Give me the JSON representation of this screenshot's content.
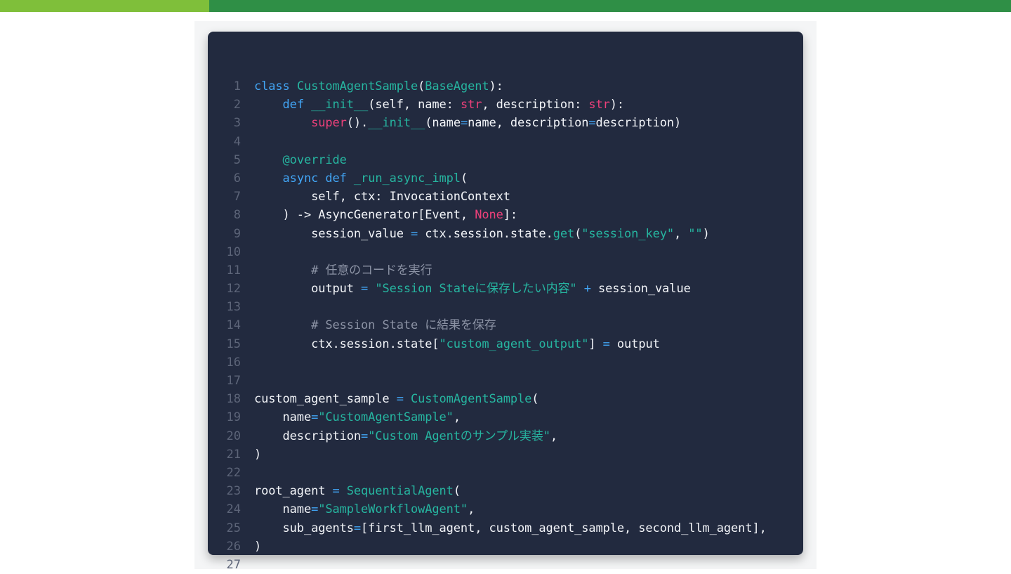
{
  "colors": {
    "top_bar_light": "#7fbf3a",
    "top_bar_dark": "#2f8f46",
    "code_background": "#222a3f",
    "keyword": "#42a5f5",
    "class_name": "#26b5a0",
    "builtin": "#ec407a",
    "string": "#26b5a0",
    "comment": "#8c93a5",
    "plain": "#f2f4f8",
    "line_number": "#5d6579"
  },
  "code": {
    "language": "python",
    "lines": [
      {
        "number": "1",
        "tokens": [
          {
            "t": "keyword",
            "v": "class"
          },
          {
            "t": "plain",
            "v": " "
          },
          {
            "t": "class",
            "v": "CustomAgentSample"
          },
          {
            "t": "plain",
            "v": "("
          },
          {
            "t": "class",
            "v": "BaseAgent"
          },
          {
            "t": "plain",
            "v": "):"
          }
        ]
      },
      {
        "number": "2",
        "tokens": [
          {
            "t": "plain",
            "v": "    "
          },
          {
            "t": "keyword",
            "v": "def"
          },
          {
            "t": "plain",
            "v": " "
          },
          {
            "t": "func",
            "v": "__init__"
          },
          {
            "t": "plain",
            "v": "(self, name: "
          },
          {
            "t": "builtin",
            "v": "str"
          },
          {
            "t": "plain",
            "v": ", description: "
          },
          {
            "t": "builtin",
            "v": "str"
          },
          {
            "t": "plain",
            "v": "):"
          }
        ]
      },
      {
        "number": "3",
        "tokens": [
          {
            "t": "plain",
            "v": "        "
          },
          {
            "t": "builtin",
            "v": "super"
          },
          {
            "t": "plain",
            "v": "()."
          },
          {
            "t": "func",
            "v": "__init__"
          },
          {
            "t": "plain",
            "v": "(name"
          },
          {
            "t": "operator",
            "v": "="
          },
          {
            "t": "plain",
            "v": "name, description"
          },
          {
            "t": "operator",
            "v": "="
          },
          {
            "t": "plain",
            "v": "description)"
          }
        ]
      },
      {
        "number": "4",
        "tokens": []
      },
      {
        "number": "5",
        "tokens": [
          {
            "t": "plain",
            "v": "    "
          },
          {
            "t": "decorator",
            "v": "@override"
          }
        ]
      },
      {
        "number": "6",
        "tokens": [
          {
            "t": "plain",
            "v": "    "
          },
          {
            "t": "keyword",
            "v": "async"
          },
          {
            "t": "plain",
            "v": " "
          },
          {
            "t": "keyword",
            "v": "def"
          },
          {
            "t": "plain",
            "v": " "
          },
          {
            "t": "func",
            "v": "_run_async_impl"
          },
          {
            "t": "plain",
            "v": "("
          }
        ]
      },
      {
        "number": "7",
        "tokens": [
          {
            "t": "plain",
            "v": "        self, ctx: InvocationContext"
          }
        ]
      },
      {
        "number": "8",
        "tokens": [
          {
            "t": "plain",
            "v": "    ) -> AsyncGenerator[Event, "
          },
          {
            "t": "builtin",
            "v": "None"
          },
          {
            "t": "plain",
            "v": "]:"
          }
        ]
      },
      {
        "number": "9",
        "tokens": [
          {
            "t": "plain",
            "v": "        session_value "
          },
          {
            "t": "operator",
            "v": "="
          },
          {
            "t": "plain",
            "v": " ctx.session.state."
          },
          {
            "t": "func",
            "v": "get"
          },
          {
            "t": "plain",
            "v": "("
          },
          {
            "t": "string",
            "v": "\"session_key\""
          },
          {
            "t": "plain",
            "v": ", "
          },
          {
            "t": "string",
            "v": "\"\""
          },
          {
            "t": "plain",
            "v": ")"
          }
        ]
      },
      {
        "number": "10",
        "tokens": []
      },
      {
        "number": "11",
        "tokens": [
          {
            "t": "plain",
            "v": "        "
          },
          {
            "t": "comment",
            "v": "# 任意のコードを実行"
          }
        ]
      },
      {
        "number": "12",
        "tokens": [
          {
            "t": "plain",
            "v": "        output "
          },
          {
            "t": "operator",
            "v": "="
          },
          {
            "t": "plain",
            "v": " "
          },
          {
            "t": "string",
            "v": "\"Session Stateに保存したい内容\""
          },
          {
            "t": "plain",
            "v": " "
          },
          {
            "t": "operator",
            "v": "+"
          },
          {
            "t": "plain",
            "v": " session_value"
          }
        ]
      },
      {
        "number": "13",
        "tokens": []
      },
      {
        "number": "14",
        "tokens": [
          {
            "t": "plain",
            "v": "        "
          },
          {
            "t": "comment",
            "v": "# Session State に結果を保存"
          }
        ]
      },
      {
        "number": "15",
        "tokens": [
          {
            "t": "plain",
            "v": "        ctx.session.state["
          },
          {
            "t": "string",
            "v": "\"custom_agent_output\""
          },
          {
            "t": "plain",
            "v": "] "
          },
          {
            "t": "operator",
            "v": "="
          },
          {
            "t": "plain",
            "v": " output"
          }
        ]
      },
      {
        "number": "16",
        "tokens": []
      },
      {
        "number": "17",
        "tokens": []
      },
      {
        "number": "18",
        "tokens": [
          {
            "t": "plain",
            "v": "custom_agent_sample "
          },
          {
            "t": "operator",
            "v": "="
          },
          {
            "t": "plain",
            "v": " "
          },
          {
            "t": "class",
            "v": "CustomAgentSample"
          },
          {
            "t": "plain",
            "v": "("
          }
        ]
      },
      {
        "number": "19",
        "tokens": [
          {
            "t": "plain",
            "v": "    name"
          },
          {
            "t": "operator",
            "v": "="
          },
          {
            "t": "string",
            "v": "\"CustomAgentSample\""
          },
          {
            "t": "plain",
            "v": ","
          }
        ]
      },
      {
        "number": "20",
        "tokens": [
          {
            "t": "plain",
            "v": "    description"
          },
          {
            "t": "operator",
            "v": "="
          },
          {
            "t": "string",
            "v": "\"Custom Agentのサンプル実装\""
          },
          {
            "t": "plain",
            "v": ","
          }
        ]
      },
      {
        "number": "21",
        "tokens": [
          {
            "t": "plain",
            "v": ")"
          }
        ]
      },
      {
        "number": "22",
        "tokens": []
      },
      {
        "number": "23",
        "tokens": [
          {
            "t": "plain",
            "v": "root_agent "
          },
          {
            "t": "operator",
            "v": "="
          },
          {
            "t": "plain",
            "v": " "
          },
          {
            "t": "class",
            "v": "SequentialAgent"
          },
          {
            "t": "plain",
            "v": "("
          }
        ]
      },
      {
        "number": "24",
        "tokens": [
          {
            "t": "plain",
            "v": "    name"
          },
          {
            "t": "operator",
            "v": "="
          },
          {
            "t": "string",
            "v": "\"SampleWorkflowAgent\""
          },
          {
            "t": "plain",
            "v": ","
          }
        ]
      },
      {
        "number": "25",
        "tokens": [
          {
            "t": "plain",
            "v": "    sub_agents"
          },
          {
            "t": "operator",
            "v": "="
          },
          {
            "t": "plain",
            "v": "[first_llm_agent, custom_agent_sample, second_llm_agent],"
          }
        ]
      },
      {
        "number": "26",
        "tokens": [
          {
            "t": "plain",
            "v": ")"
          }
        ]
      },
      {
        "number": "27",
        "tokens": []
      }
    ]
  }
}
